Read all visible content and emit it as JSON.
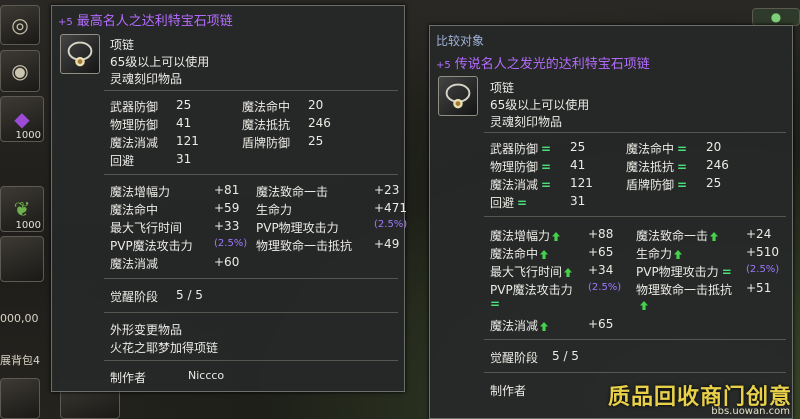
{
  "left": {
    "title_plus": "+5",
    "title": "最高名人之达利特宝石项链",
    "type": "项链",
    "level": "65级以上可以使用",
    "bind": "灵魂刻印物品",
    "stats": [
      [
        "武器防御",
        "25",
        "魔法命中",
        "20"
      ],
      [
        "物理防御",
        "41",
        "魔法抵抗",
        "246"
      ],
      [
        "魔法消减",
        "121",
        "盾牌防御",
        "25"
      ],
      [
        "回避",
        "31",
        "",
        ""
      ]
    ],
    "bonus": [
      [
        "魔法增幅力",
        "+81",
        "魔法致命一击",
        "+23"
      ],
      [
        "魔法命中",
        "+59",
        "生命力",
        "+471"
      ],
      [
        "最大飞行时间",
        "+33",
        "PVP物理攻击力",
        "(2.5%)"
      ],
      [
        "PVP魔法攻击力",
        "(2.5%)",
        "物理致命一击抵抗",
        "+49"
      ],
      [
        "魔法消减",
        "+60",
        "",
        ""
      ]
    ],
    "awaken_label": "觉醒阶段",
    "awaken_value": "5 / 5",
    "skin_label": "外形变更物品",
    "skin_value": "火花之耶梦加得项链",
    "maker_label": "制作者",
    "maker_value": "Niccco"
  },
  "right": {
    "compare_label": "比较对象",
    "title_plus": "+5",
    "title": "传说名人之发光的达利特宝石项链",
    "type": "项链",
    "level": "65级以上可以使用",
    "bind": "灵魂刻印物品",
    "stats": [
      [
        "武器防御",
        "25",
        "魔法命中",
        "20"
      ],
      [
        "物理防御",
        "41",
        "魔法抵抗",
        "246"
      ],
      [
        "魔法消减",
        "121",
        "盾牌防御",
        "25"
      ],
      [
        "回避",
        "31",
        "",
        ""
      ]
    ],
    "bonus": [
      [
        "魔法增幅力",
        "+88",
        "魔法致命一击",
        "+24"
      ],
      [
        "魔法命中",
        "+65",
        "生命力",
        "+510"
      ],
      [
        "最大飞行时间",
        "+34",
        "PVP物理攻击力",
        "(2.5%)"
      ],
      [
        "PVP魔法攻击力",
        "(2.5%)",
        "物理致命一击抵抗",
        "+51"
      ],
      [
        "魔法消减",
        "+65",
        "",
        ""
      ]
    ],
    "awaken_label": "觉醒阶段",
    "awaken_value": "5 / 5",
    "maker_label": "制作者"
  },
  "bg": {
    "count1": "1000",
    "count2": "1000",
    "money": "000,00",
    "bag_label": "展背包4"
  },
  "watermark": {
    "main": "质品回收商门创意",
    "sub": "bbs.uowan.com"
  },
  "colors": {
    "title": "#b56bff",
    "compare": "#9fb2d8",
    "up": "#45d14b",
    "equal": "#4be07a"
  }
}
